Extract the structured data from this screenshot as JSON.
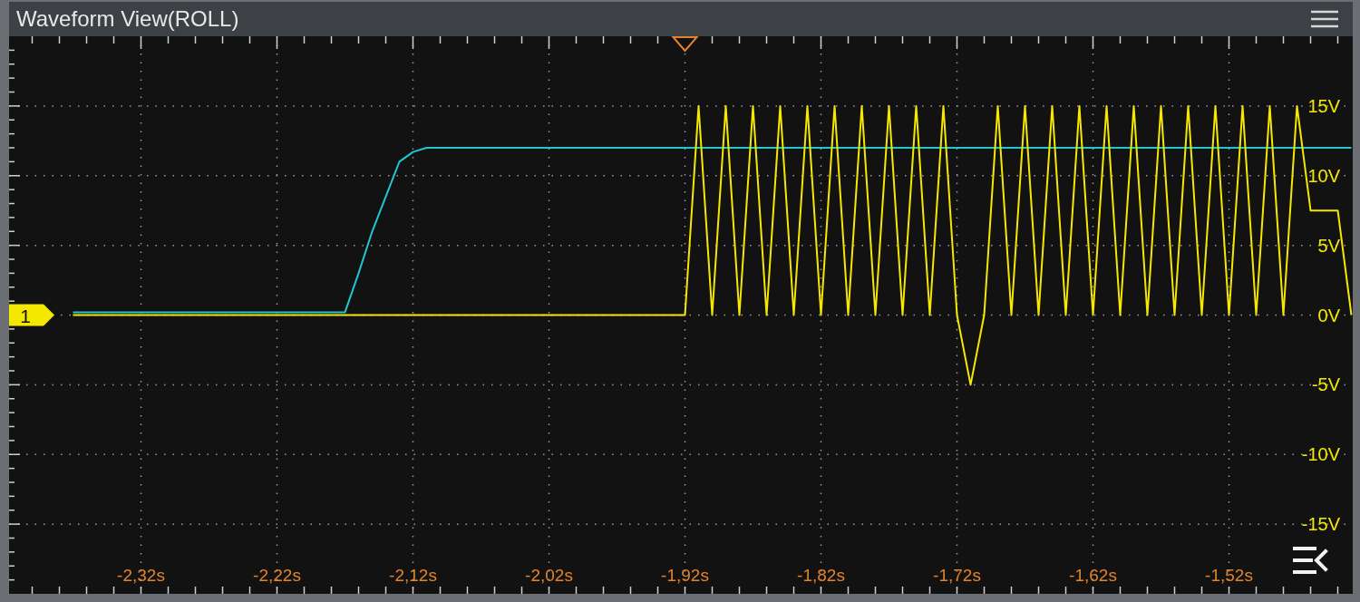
{
  "window": {
    "title": "Waveform View(ROLL)"
  },
  "channel_marker": {
    "label": "1",
    "color": "#f5e800"
  },
  "chart_data": {
    "type": "line",
    "x": [
      -2.37,
      -2.36,
      -2.35,
      -2.34,
      -2.33,
      -2.32,
      -2.31,
      -2.3,
      -2.29,
      -2.28,
      -2.27,
      -2.26,
      -2.25,
      -2.24,
      -2.23,
      -2.22,
      -2.21,
      -2.2,
      -2.19,
      -2.18,
      -2.17,
      -2.16,
      -2.15,
      -2.14,
      -2.13,
      -2.12,
      -2.11,
      -2.1,
      -2.09,
      -2.08,
      -2.07,
      -2.06,
      -2.05,
      -2.04,
      -2.03,
      -2.02,
      -2.01,
      -2.0,
      -1.99,
      -1.98,
      -1.97,
      -1.96,
      -1.95,
      -1.94,
      -1.93,
      -1.92,
      -1.91,
      -1.9,
      -1.89,
      -1.88,
      -1.87,
      -1.86,
      -1.85,
      -1.84,
      -1.83,
      -1.82,
      -1.81,
      -1.8,
      -1.79,
      -1.78,
      -1.77,
      -1.76,
      -1.75,
      -1.74,
      -1.73,
      -1.72,
      -1.71,
      -1.7,
      -1.69,
      -1.68,
      -1.67,
      -1.66,
      -1.65,
      -1.64,
      -1.63,
      -1.62,
      -1.61,
      -1.6,
      -1.59,
      -1.58,
      -1.57,
      -1.56,
      -1.55,
      -1.54,
      -1.53,
      -1.52,
      -1.51,
      -1.5,
      -1.49,
      -1.48,
      -1.47,
      -1.46,
      -1.45,
      -1.44,
      -1.43
    ],
    "series": [
      {
        "color": "#1fc8d0",
        "values": [
          0.2,
          0.2,
          0.2,
          0.2,
          0.2,
          0.2,
          0.2,
          0.2,
          0.2,
          0.2,
          0.2,
          0.2,
          0.2,
          0.2,
          0.2,
          0.2,
          0.2,
          0.2,
          0.2,
          0.2,
          0.2,
          3,
          6,
          8.5,
          11,
          11.7,
          12,
          12,
          12,
          12,
          12,
          12,
          12,
          12,
          12,
          12,
          12,
          12,
          12,
          12,
          12,
          12,
          12,
          12,
          12,
          12,
          12,
          12,
          12,
          12,
          12,
          12,
          12,
          12,
          12,
          12,
          12,
          12,
          12,
          12,
          12,
          12,
          12,
          12,
          12,
          12,
          12,
          12,
          12,
          12,
          12,
          12,
          12,
          12,
          12,
          12,
          12,
          12,
          12,
          12,
          12,
          12,
          12,
          12,
          12,
          12,
          12,
          12,
          12,
          12,
          12,
          12,
          12,
          12,
          12
        ]
      },
      {
        "color": "#f5e800",
        "values": [
          0,
          0,
          0,
          0,
          0,
          0,
          0,
          0,
          0,
          0,
          0,
          0,
          0,
          0,
          0,
          0,
          0,
          0,
          0,
          0,
          0,
          0,
          0,
          0,
          0,
          0,
          0,
          0,
          0,
          0,
          0,
          0,
          0,
          0,
          0,
          0,
          0,
          0,
          0,
          0,
          0,
          0,
          0,
          0,
          0,
          0,
          15,
          0,
          15,
          0,
          15,
          0,
          15,
          0,
          15,
          0,
          15,
          0,
          15,
          0,
          15,
          0,
          15,
          0,
          15,
          0,
          -5,
          0,
          15,
          0,
          15,
          0,
          15,
          0,
          15,
          0,
          15,
          0,
          15,
          0,
          15,
          0,
          15,
          0,
          15,
          0,
          15,
          0,
          15,
          0,
          15,
          7.5,
          7.5,
          7.5,
          0
        ]
      }
    ],
    "xlim": [
      -2.417,
      -1.429
    ],
    "ylim": [
      -20,
      20
    ],
    "grid": true,
    "xticks": [
      {
        "value": -2.32,
        "label": "-2,32s"
      },
      {
        "value": -2.22,
        "label": "-2,22s"
      },
      {
        "value": -2.12,
        "label": "-2,12s"
      },
      {
        "value": -2.02,
        "label": "-2,02s"
      },
      {
        "value": -1.92,
        "label": "-1,92s"
      },
      {
        "value": -1.82,
        "label": "-1,82s"
      },
      {
        "value": -1.72,
        "label": "-1,72s"
      },
      {
        "value": -1.62,
        "label": "-1,62s"
      },
      {
        "value": -1.52,
        "label": "-1,52s"
      }
    ],
    "yticks": [
      {
        "value": 15,
        "label": "15V"
      },
      {
        "value": 10,
        "label": "10V"
      },
      {
        "value": 5,
        "label": "5V"
      },
      {
        "value": 0,
        "label": "0V"
      },
      {
        "value": -5,
        "label": "-5V"
      },
      {
        "value": -10,
        "label": "-10V"
      },
      {
        "value": -15,
        "label": "-15V"
      }
    ]
  }
}
